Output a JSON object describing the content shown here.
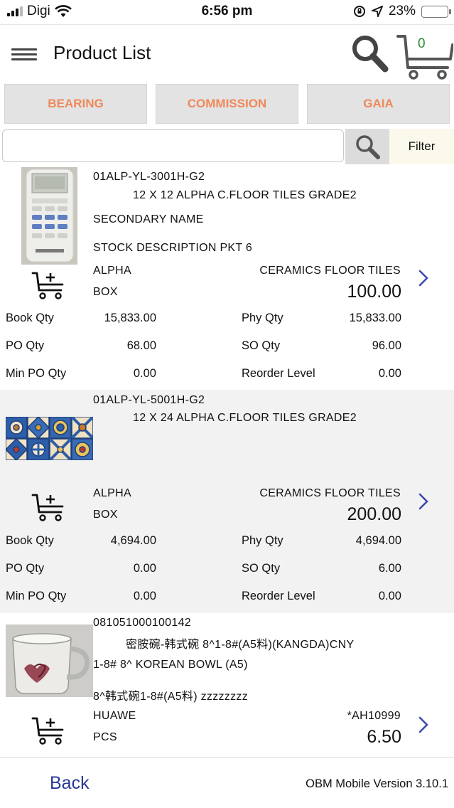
{
  "status_bar": {
    "carrier": "Digi",
    "time": "6:56 pm",
    "battery": "23%"
  },
  "header": {
    "title": "Product List",
    "cart_count": "0"
  },
  "categories": [
    "BEARING",
    "COMMISSION",
    "GAIA"
  ],
  "search": {
    "placeholder": "",
    "filter_label": "Filter"
  },
  "products": [
    {
      "code": "01ALP-YL-3001H-G2",
      "name": "12 X 12 ALPHA C.FLOOR TILES GRADE2",
      "line3": "SECONDARY NAME",
      "line4": "STOCK DESCRIPTION PKT 6",
      "brand": "ALPHA",
      "category": "CERAMICS FLOOR TILES",
      "uom": "BOX",
      "price": "100.00",
      "book_qty_label": "Book Qty",
      "book_qty": "15,833.00",
      "phy_qty_label": "Phy Qty",
      "phy_qty": "15,833.00",
      "po_qty_label": "PO Qty",
      "po_qty": "68.00",
      "so_qty_label": "SO Qty",
      "so_qty": "96.00",
      "min_po_qty_label": "Min PO Qty",
      "min_po_qty": "0.00",
      "reorder_level_label": "Reorder Level",
      "reorder_level": "0.00",
      "image": "remote-control-icon"
    },
    {
      "code": "01ALP-YL-5001H-G2",
      "name": "12 X 24 ALPHA C.FLOOR TILES GRADE2",
      "brand": "ALPHA",
      "category": "CERAMICS FLOOR TILES",
      "uom": "BOX",
      "price": "200.00",
      "book_qty_label": "Book Qty",
      "book_qty": "4,694.00",
      "phy_qty_label": "Phy Qty",
      "phy_qty": "4,694.00",
      "po_qty_label": "PO Qty",
      "po_qty": "0.00",
      "so_qty_label": "SO Qty",
      "so_qty": "6.00",
      "min_po_qty_label": "Min PO Qty",
      "min_po_qty": "0.00",
      "reorder_level_label": "Reorder Level",
      "reorder_level": "0.00",
      "image": "tile-pattern-icon"
    },
    {
      "code": "081051000100142",
      "name": "密胺碗-韩式碗 8^1-8#(A5料)(KANGDA)CNY",
      "line3": "1-8# 8^ KOREAN BOWL (A5)",
      "line4": "8^韩式碗1-8#(A5料) zzzzzzzz",
      "brand": "HUAWE",
      "category": "*AH10999",
      "uom": "PCS",
      "price": "6.50",
      "image": "cup-icon"
    }
  ],
  "footer": {
    "back_label": "Back",
    "version": "OBM Mobile Version 3.10.1"
  },
  "colors": {
    "category_text": "#f0885a",
    "back_link": "#2a3a9a",
    "chevron": "#3d4bb0",
    "cart_count": "#2e8b2e"
  }
}
